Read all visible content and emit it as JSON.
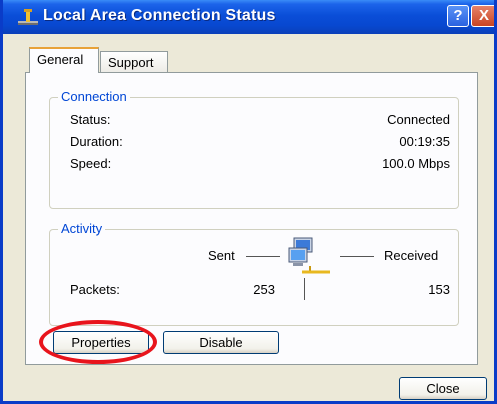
{
  "window": {
    "title": "Local Area Connection Status",
    "help_button": "?",
    "close_glyph": "X"
  },
  "tabs": [
    {
      "label": "General",
      "selected": true
    },
    {
      "label": "Support",
      "selected": false
    }
  ],
  "connection": {
    "legend": "Connection",
    "status_label": "Status:",
    "status_value": "Connected",
    "duration_label": "Duration:",
    "duration_value": "00:19:35",
    "speed_label": "Speed:",
    "speed_value": "100.0 Mbps"
  },
  "activity": {
    "legend": "Activity",
    "sent_label": "Sent",
    "received_label": "Received",
    "packets_label": "Packets:",
    "packets_sent": "253",
    "packets_received": "153",
    "icon": "network-computers-icon"
  },
  "buttons": {
    "properties": "Properties",
    "disable": "Disable",
    "close": "Close"
  },
  "annotation": {
    "highlight_color": "#e8141c",
    "target": "Properties"
  },
  "colors": {
    "titlebar": "#0a4ed8",
    "legend_text": "#0046d5",
    "tab_accent": "#e8a238"
  }
}
